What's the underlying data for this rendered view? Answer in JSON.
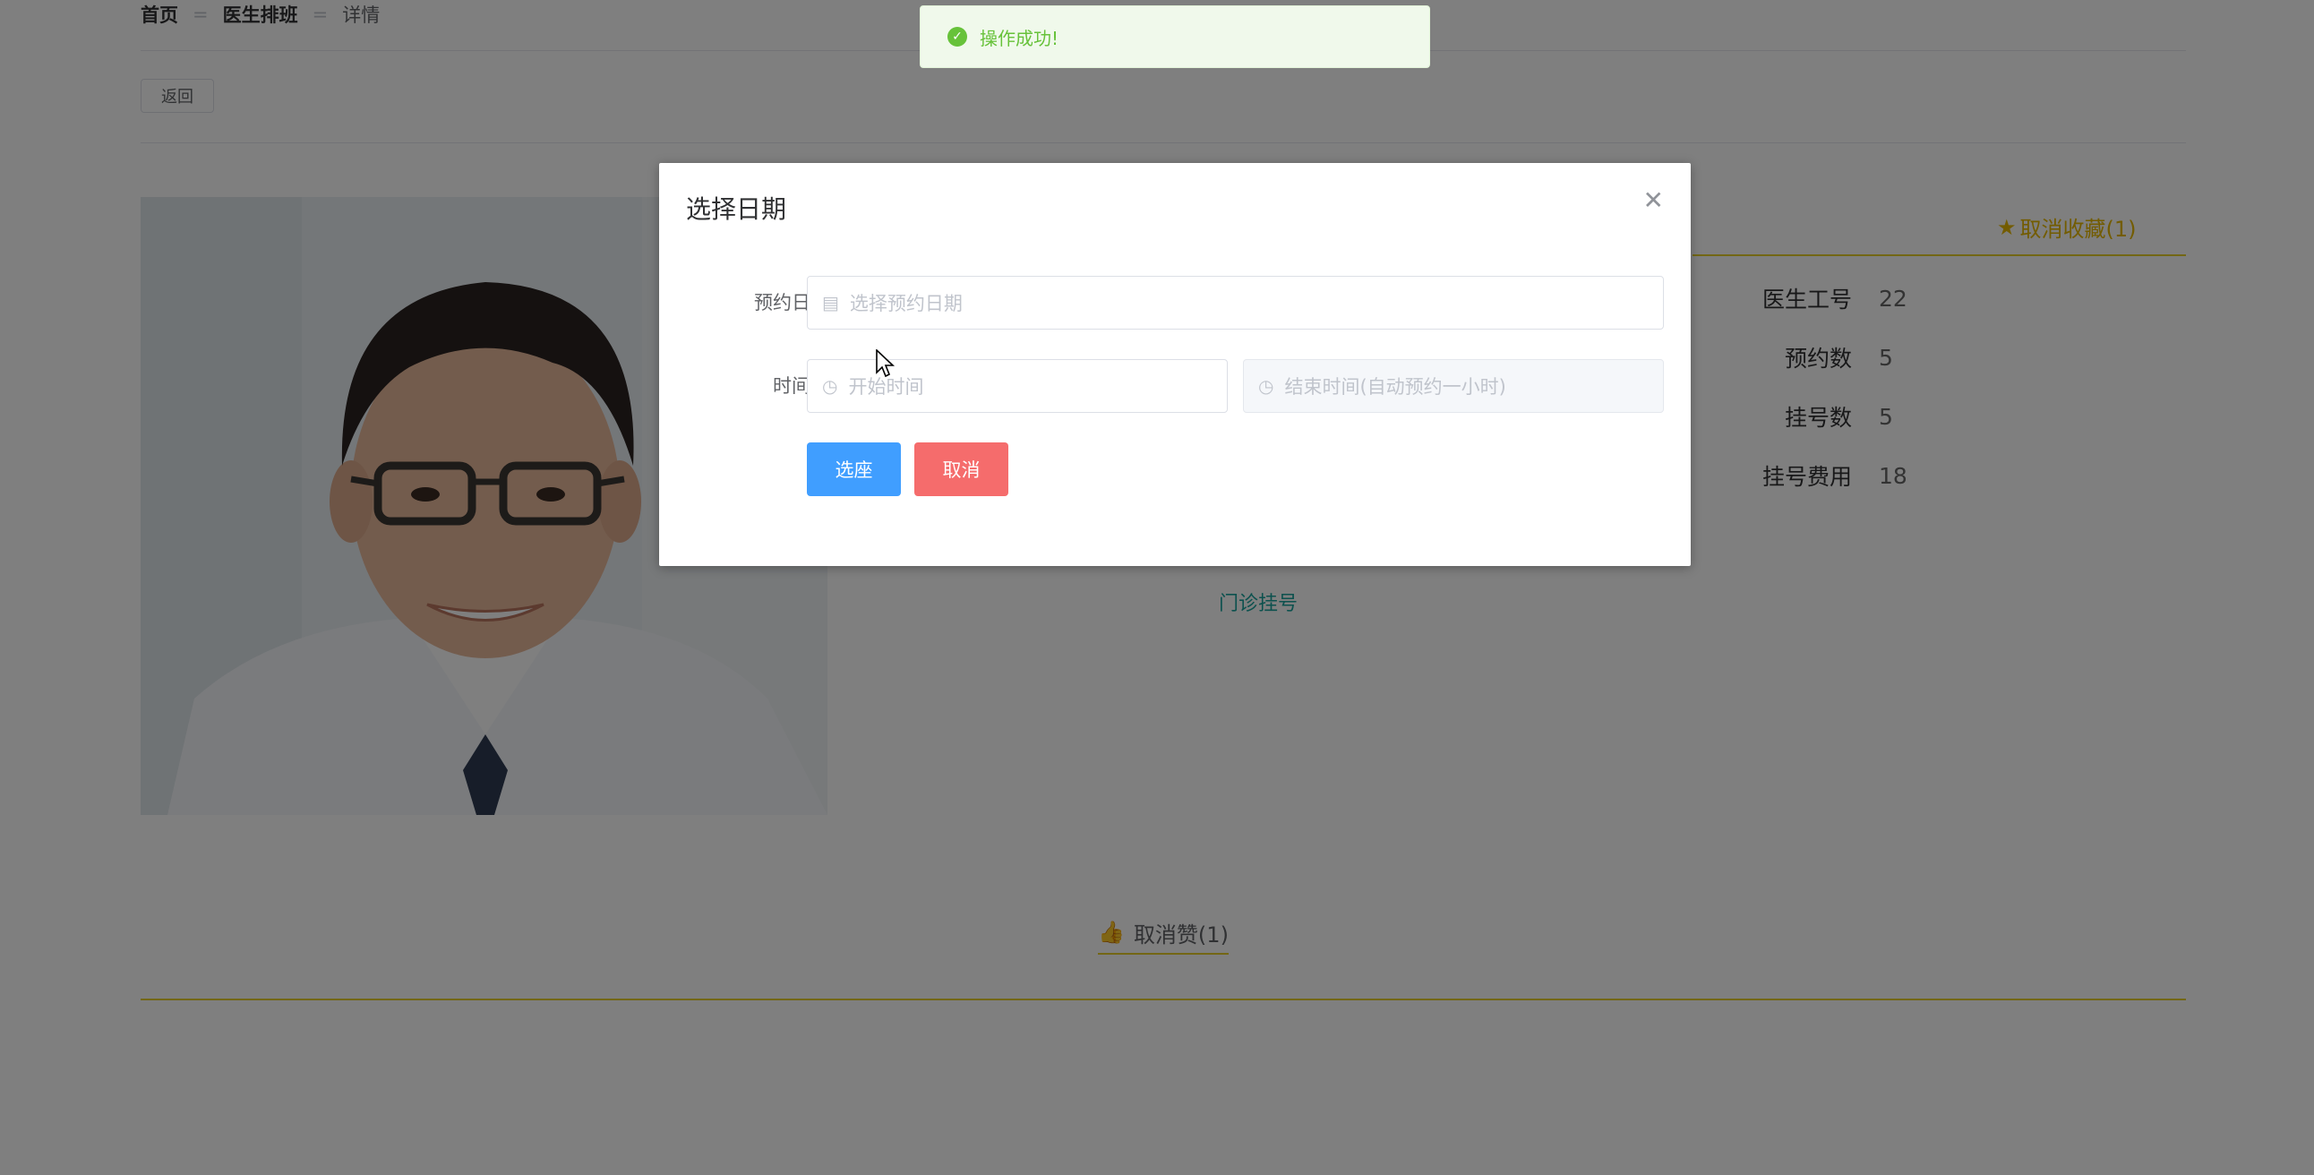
{
  "breadcrumb": {
    "home": "首页",
    "schedule": "医生排班",
    "detail": "详情",
    "separator": "="
  },
  "back_button": "返回",
  "favorite_link": "取消收藏(1)",
  "info": [
    {
      "label": "医生工号",
      "value": "22"
    },
    {
      "label": "预约数",
      "value": "5"
    },
    {
      "label": "挂号数",
      "value": "5"
    },
    {
      "label": "挂号费用",
      "value": "18"
    }
  ],
  "clinic_link": "门诊挂号",
  "like_button": "取消赞(1)",
  "toast": {
    "message": "操作成功!"
  },
  "dialog": {
    "title": "选择日期",
    "date_label": "预约日期",
    "date_placeholder": "选择预约日期",
    "time_label": "时间段",
    "start_placeholder": "开始时间",
    "end_placeholder": "结束时间(自动预约一小时)",
    "confirm_button": "选座",
    "cancel_button": "取消"
  },
  "colors": {
    "primary": "#409eff",
    "danger": "#f56c6c",
    "success": "#67c23a",
    "gold": "#e6b800",
    "teal": "#1aa39d"
  }
}
